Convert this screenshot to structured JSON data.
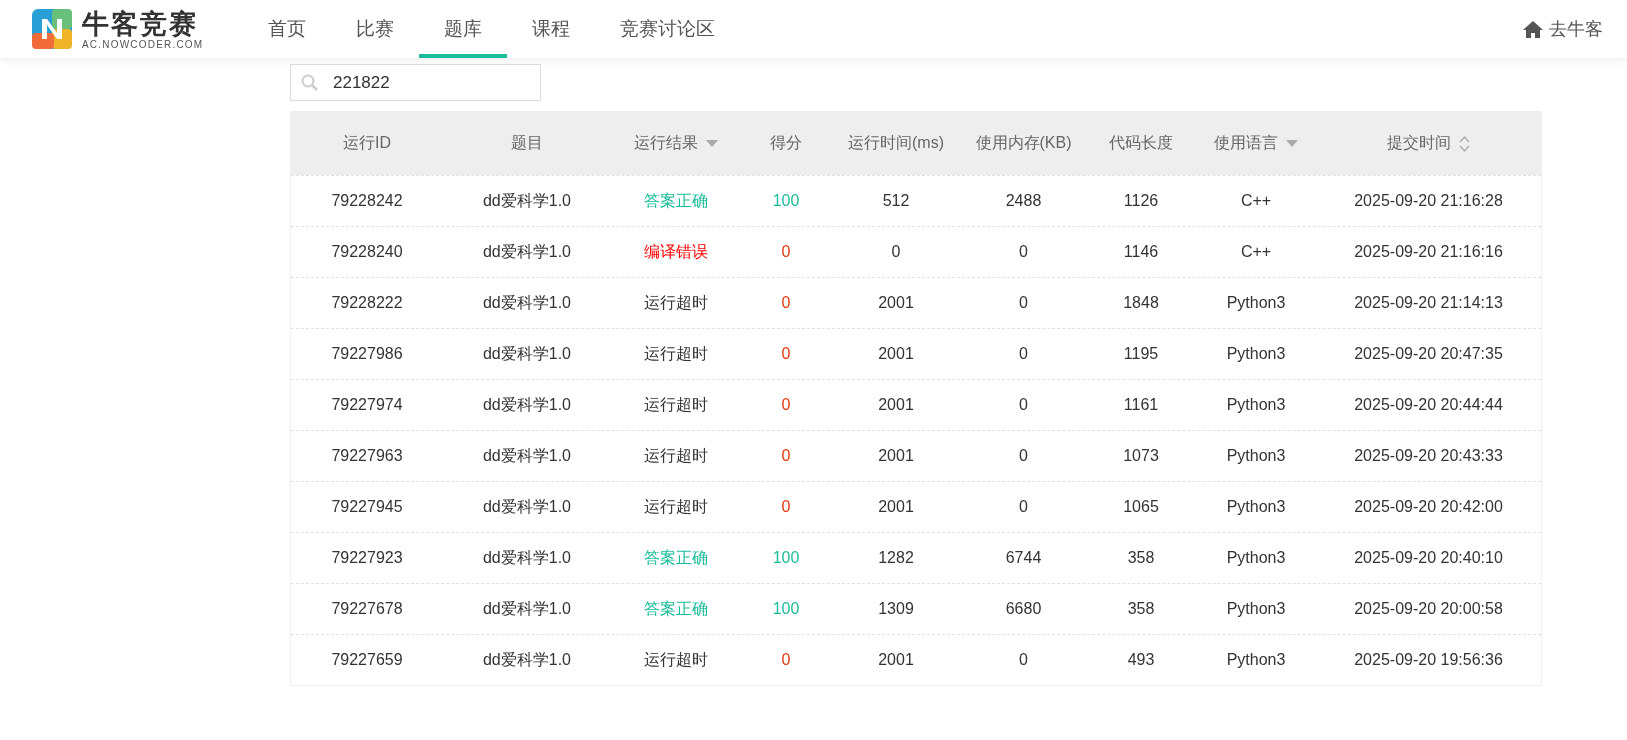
{
  "header": {
    "logo_title": "牛客竞赛",
    "logo_subtitle": "AC.NOWCODER.COM",
    "nav": [
      {
        "label": "首页",
        "selected": false
      },
      {
        "label": "比赛",
        "selected": false
      },
      {
        "label": "题库",
        "selected": true
      },
      {
        "label": "课程",
        "selected": false
      },
      {
        "label": "竞赛讨论区",
        "selected": false
      }
    ],
    "home_link": "去牛客"
  },
  "search": {
    "value": "221822"
  },
  "table": {
    "columns": [
      {
        "label": "运行ID"
      },
      {
        "label": "题目"
      },
      {
        "label": "运行结果",
        "filter": true
      },
      {
        "label": "得分"
      },
      {
        "label": "运行时间(ms)"
      },
      {
        "label": "使用内存(KB)"
      },
      {
        "label": "代码长度"
      },
      {
        "label": "使用语言",
        "filter": true
      },
      {
        "label": "提交时间",
        "sortable": true
      }
    ],
    "rows": [
      {
        "id": "79228242",
        "problem": "dd爱科学1.0",
        "result": {
          "text": "答案正确",
          "color": "#1bbc9b"
        },
        "score": {
          "text": "100",
          "color": "#1bbc9b"
        },
        "time": "512",
        "memory": "2488",
        "length": "1126",
        "language": "C++",
        "submitted": "2025-09-20 21:16:28"
      },
      {
        "id": "79228240",
        "problem": "dd爱科学1.0",
        "result": {
          "text": "编译错误",
          "color": "#ff0000"
        },
        "score": {
          "text": "0",
          "color": "#e8380d"
        },
        "time": "0",
        "memory": "0",
        "length": "1146",
        "language": "C++",
        "submitted": "2025-09-20 21:16:16"
      },
      {
        "id": "79228222",
        "problem": "dd爱科学1.0",
        "result": {
          "text": "运行超时",
          "color": "#333333"
        },
        "score": {
          "text": "0",
          "color": "#e8380d"
        },
        "time": "2001",
        "memory": "0",
        "length": "1848",
        "language": "Python3",
        "submitted": "2025-09-20 21:14:13"
      },
      {
        "id": "79227986",
        "problem": "dd爱科学1.0",
        "result": {
          "text": "运行超时",
          "color": "#333333"
        },
        "score": {
          "text": "0",
          "color": "#e8380d"
        },
        "time": "2001",
        "memory": "0",
        "length": "1195",
        "language": "Python3",
        "submitted": "2025-09-20 20:47:35"
      },
      {
        "id": "79227974",
        "problem": "dd爱科学1.0",
        "result": {
          "text": "运行超时",
          "color": "#333333"
        },
        "score": {
          "text": "0",
          "color": "#e8380d"
        },
        "time": "2001",
        "memory": "0",
        "length": "1161",
        "language": "Python3",
        "submitted": "2025-09-20 20:44:44"
      },
      {
        "id": "79227963",
        "problem": "dd爱科学1.0",
        "result": {
          "text": "运行超时",
          "color": "#333333"
        },
        "score": {
          "text": "0",
          "color": "#e8380d"
        },
        "time": "2001",
        "memory": "0",
        "length": "1073",
        "language": "Python3",
        "submitted": "2025-09-20 20:43:33"
      },
      {
        "id": "79227945",
        "problem": "dd爱科学1.0",
        "result": {
          "text": "运行超时",
          "color": "#333333"
        },
        "score": {
          "text": "0",
          "color": "#e8380d"
        },
        "time": "2001",
        "memory": "0",
        "length": "1065",
        "language": "Python3",
        "submitted": "2025-09-20 20:42:00"
      },
      {
        "id": "79227923",
        "problem": "dd爱科学1.0",
        "result": {
          "text": "答案正确",
          "color": "#1bbc9b"
        },
        "score": {
          "text": "100",
          "color": "#1bbc9b"
        },
        "time": "1282",
        "memory": "6744",
        "length": "358",
        "language": "Python3",
        "submitted": "2025-09-20 20:40:10"
      },
      {
        "id": "79227678",
        "problem": "dd爱科学1.0",
        "result": {
          "text": "答案正确",
          "color": "#1bbc9b"
        },
        "score": {
          "text": "100",
          "color": "#1bbc9b"
        },
        "time": "1309",
        "memory": "6680",
        "length": "358",
        "language": "Python3",
        "submitted": "2025-09-20 20:00:58"
      },
      {
        "id": "79227659",
        "problem": "dd爱科学1.0",
        "result": {
          "text": "运行超时",
          "color": "#333333"
        },
        "score": {
          "text": "0",
          "color": "#e8380d"
        },
        "time": "2001",
        "memory": "0",
        "length": "493",
        "language": "Python3",
        "submitted": "2025-09-20 19:56:36"
      }
    ]
  }
}
